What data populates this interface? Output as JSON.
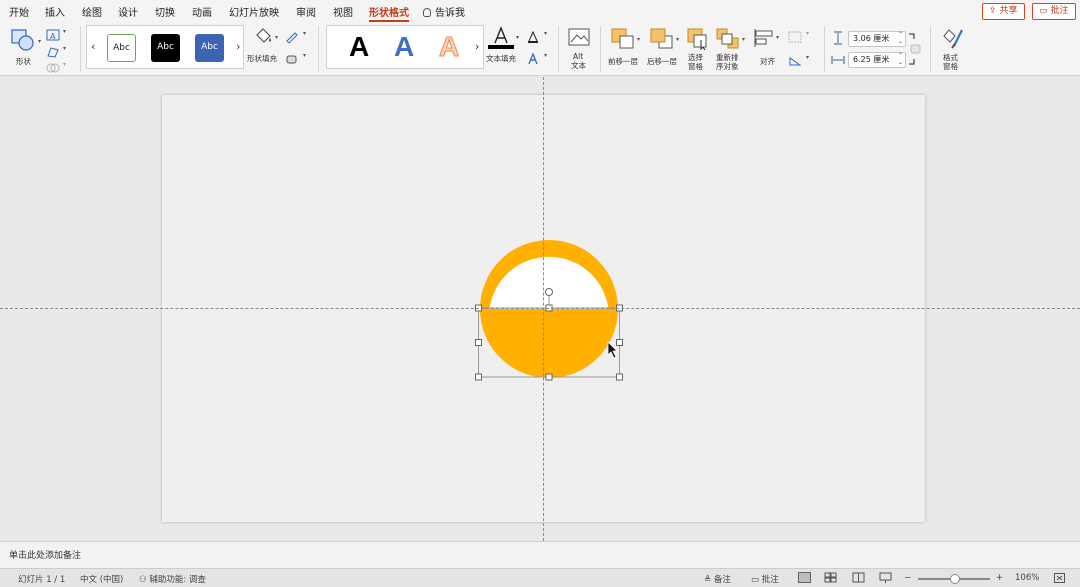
{
  "tabs": [
    {
      "label": "开始",
      "active": false
    },
    {
      "label": "插入",
      "active": false
    },
    {
      "label": "绘图",
      "active": false
    },
    {
      "label": "设计",
      "active": false
    },
    {
      "label": "切换",
      "active": false
    },
    {
      "label": "动画",
      "active": false
    },
    {
      "label": "幻灯片放映",
      "active": false
    },
    {
      "label": "审阅",
      "active": false
    },
    {
      "label": "视图",
      "active": false
    },
    {
      "label": "形状格式",
      "active": true
    }
  ],
  "tell_me": "告诉我",
  "share_button": "共享",
  "comment_button": "批注",
  "ribbon": {
    "shapes_label": "形状",
    "style_samples": [
      "Abc",
      "Abc",
      "Abc"
    ],
    "shape_fill_label": "形状填充",
    "wordart_letters": [
      "A",
      "A",
      "A"
    ],
    "text_fill_label": "文本填充",
    "alt_text_line1": "Alt",
    "alt_text_line2": "文本",
    "bring_forward": "前移一层",
    "send_backward": "后移一层",
    "selection_pane_1": "选择",
    "selection_pane_2": "窗格",
    "reorder_1": "重新排",
    "reorder_2": "序对象",
    "align_label": "对齐",
    "height_value": "3.06 厘米",
    "width_value": "6.25 厘米",
    "format_pane_1": "格式",
    "format_pane_2": "窗格"
  },
  "slide": {
    "shape_colors": {
      "fill": "#FFB000",
      "inner": "#FFFFFF"
    }
  },
  "notes_placeholder": "单击此处添加备注",
  "status": {
    "slide_counter": "幻灯片 1 / 1",
    "language": "中文 (中国)",
    "accessibility": "辅助功能: 调查",
    "notes_btn": "备注",
    "comments_btn": "批注",
    "zoom_minus": "−",
    "zoom_plus": "+",
    "zoom_level": "106%"
  },
  "colors": {
    "accent": "#C43E1C",
    "abc_black": "#000000",
    "abc_blue": "#3C64B4",
    "wordart_blue": "#3C6FC4",
    "wordart_orange": "#F08A4B"
  }
}
